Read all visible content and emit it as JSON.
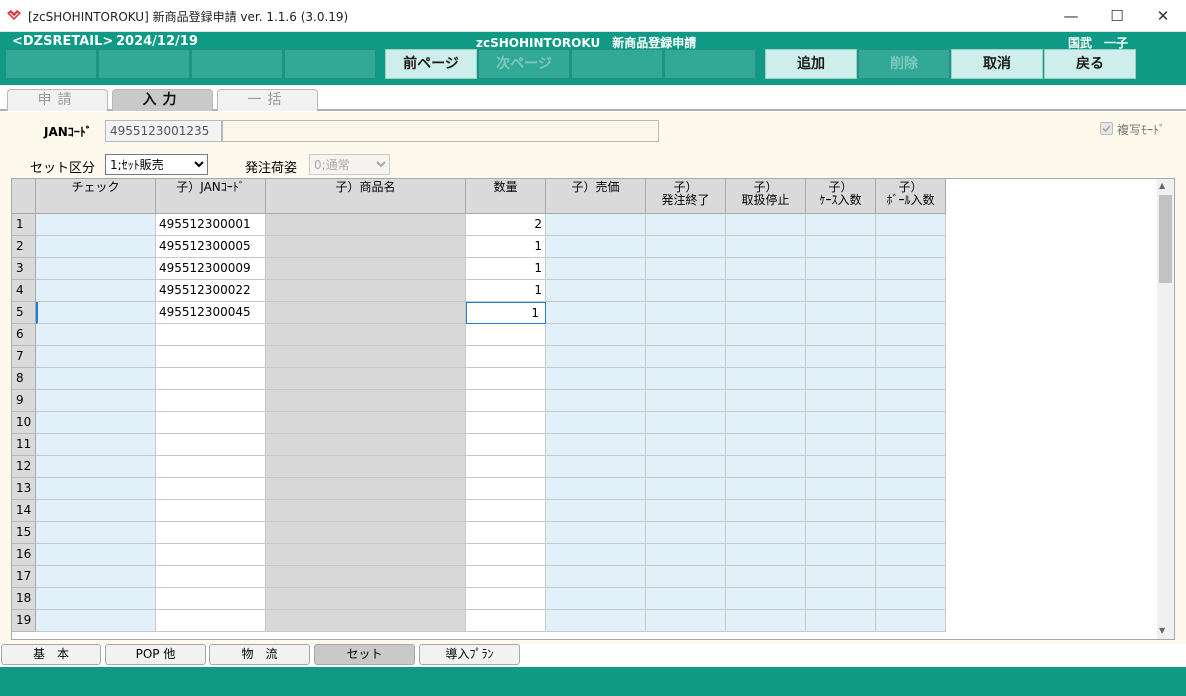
{
  "window": {
    "title": "[zcSHOHINTOROKU] 新商品登録申請 ver. 1.1.6 (3.0.19)",
    "controls": {
      "minimize": "—",
      "maximize": "☐",
      "close": "✕"
    }
  },
  "header": {
    "store": "<DZSRETAIL>",
    "date": "2024/12/19",
    "app_name": "zcSHOHINTOROKU　新商品登録申請",
    "user": "国武　一子"
  },
  "function_keys": [
    {
      "label": ""
    },
    {
      "label": ""
    },
    {
      "label": ""
    },
    {
      "label": ""
    },
    {
      "label": "前ページ"
    },
    {
      "label": "次ページ"
    },
    {
      "label": ""
    },
    {
      "label": ""
    },
    {
      "label": "追加"
    },
    {
      "label": "削除"
    },
    {
      "label": "取消"
    },
    {
      "label": "戻る"
    }
  ],
  "tabs": [
    {
      "label": "申請"
    },
    {
      "label": "入力"
    },
    {
      "label": "一括"
    }
  ],
  "form": {
    "jan_label": "JANｺｰﾄﾞ",
    "jan_value": "4955123001235",
    "copy_mode_label": "複写ﾓｰﾄﾞ",
    "set_kubun_label": "セット区分",
    "set_kubun_value": "1;ｾｯﾄ販売",
    "hatchu_label": "発注荷姿",
    "hatchu_value": "0;通常"
  },
  "grid": {
    "columns": [
      {
        "label": "チェック"
      },
      {
        "label": "子）JANｺｰﾄﾞ"
      },
      {
        "label": "子）商品名"
      },
      {
        "label": "数量"
      },
      {
        "label": "子）売価"
      },
      {
        "label": "子）\n発注終了"
      },
      {
        "label": "子）\n取扱停止"
      },
      {
        "label": "子）\nｹｰｽ入数"
      },
      {
        "label": "子）\nﾎﾞｰﾙ入数"
      }
    ],
    "rows": [
      {
        "num": "1",
        "jan": "495512300001",
        "qty": "2"
      },
      {
        "num": "2",
        "jan": "495512300005",
        "qty": "1"
      },
      {
        "num": "3",
        "jan": "495512300009",
        "qty": "1"
      },
      {
        "num": "4",
        "jan": "495512300022",
        "qty": "1"
      },
      {
        "num": "5",
        "jan": "495512300045",
        "qty": "1"
      },
      {
        "num": "6",
        "jan": "",
        "qty": ""
      },
      {
        "num": "7",
        "jan": "",
        "qty": ""
      },
      {
        "num": "8",
        "jan": "",
        "qty": ""
      },
      {
        "num": "9",
        "jan": "",
        "qty": ""
      },
      {
        "num": "10",
        "jan": "",
        "qty": ""
      },
      {
        "num": "11",
        "jan": "",
        "qty": ""
      },
      {
        "num": "12",
        "jan": "",
        "qty": ""
      },
      {
        "num": "13",
        "jan": "",
        "qty": ""
      },
      {
        "num": "14",
        "jan": "",
        "qty": ""
      },
      {
        "num": "15",
        "jan": "",
        "qty": ""
      },
      {
        "num": "16",
        "jan": "",
        "qty": ""
      },
      {
        "num": "17",
        "jan": "",
        "qty": ""
      },
      {
        "num": "18",
        "jan": "",
        "qty": ""
      },
      {
        "num": "19",
        "jan": "",
        "qty": ""
      }
    ]
  },
  "bottom_tabs": [
    {
      "label": "基　本"
    },
    {
      "label": "POP 他"
    },
    {
      "label": "物　流"
    },
    {
      "label": "セット"
    },
    {
      "label": "導入ﾌﾟﾗﾝ"
    }
  ],
  "colors": {
    "header_green": "#0f9a85",
    "cell_blue": "#e1f0f9",
    "content_bg": "#fdf9ec"
  }
}
